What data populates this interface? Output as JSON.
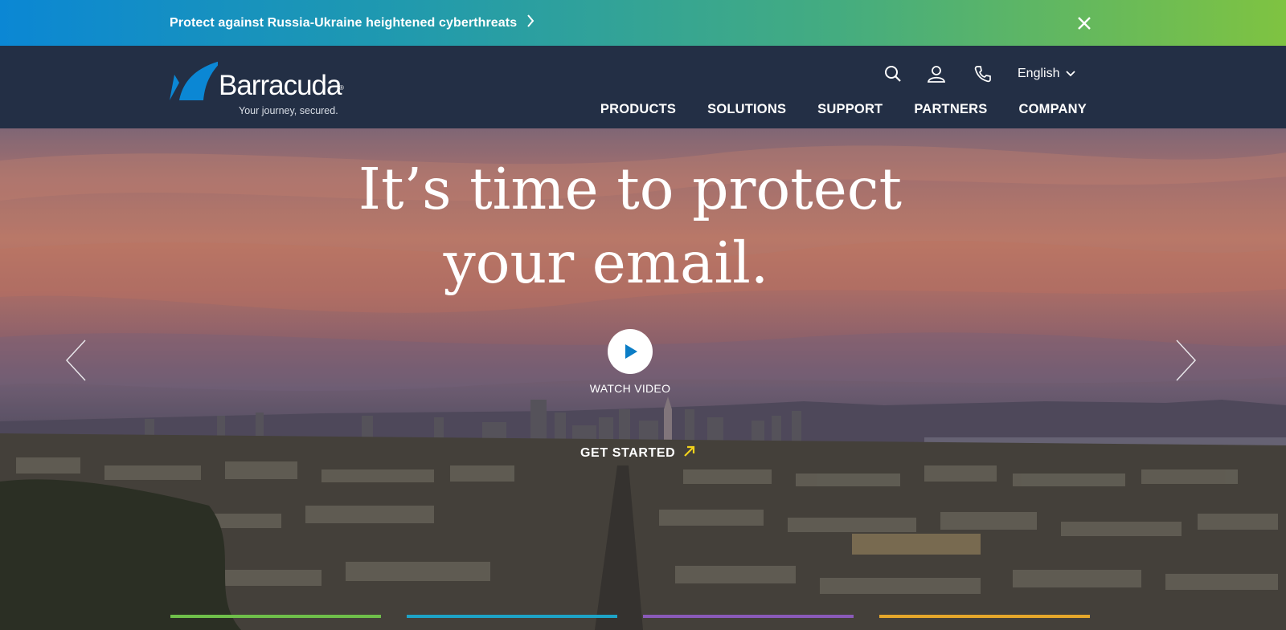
{
  "alert": {
    "text": "Protect against Russia-Ukraine heightened cyberthreats",
    "chevron_icon": "chevron-right-icon",
    "close_icon": "close-icon"
  },
  "header": {
    "logo": {
      "name": "Barracuda",
      "registered": "®",
      "tagline": "Your journey, secured."
    },
    "utility": {
      "search_icon": "search-icon",
      "account_icon": "user-icon",
      "contact_icon": "phone-icon",
      "language": "English"
    },
    "nav": [
      "PRODUCTS",
      "SOLUTIONS",
      "SUPPORT",
      "PARTNERS",
      "COMPANY"
    ]
  },
  "hero": {
    "headline_line1": "It’s time to protect",
    "headline_line2": "your email.",
    "watch_video": "WATCH VIDEO",
    "get_started": "GET STARTED",
    "prev_icon": "chevron-left-icon",
    "next_icon": "chevron-right-icon"
  },
  "colors": {
    "header_bg": "#232f45",
    "brand_blue": "#0b87d4",
    "brand_green": "#7fc341",
    "accent_yellow": "#f2d21b",
    "play_blue": "#0b7dc6"
  }
}
